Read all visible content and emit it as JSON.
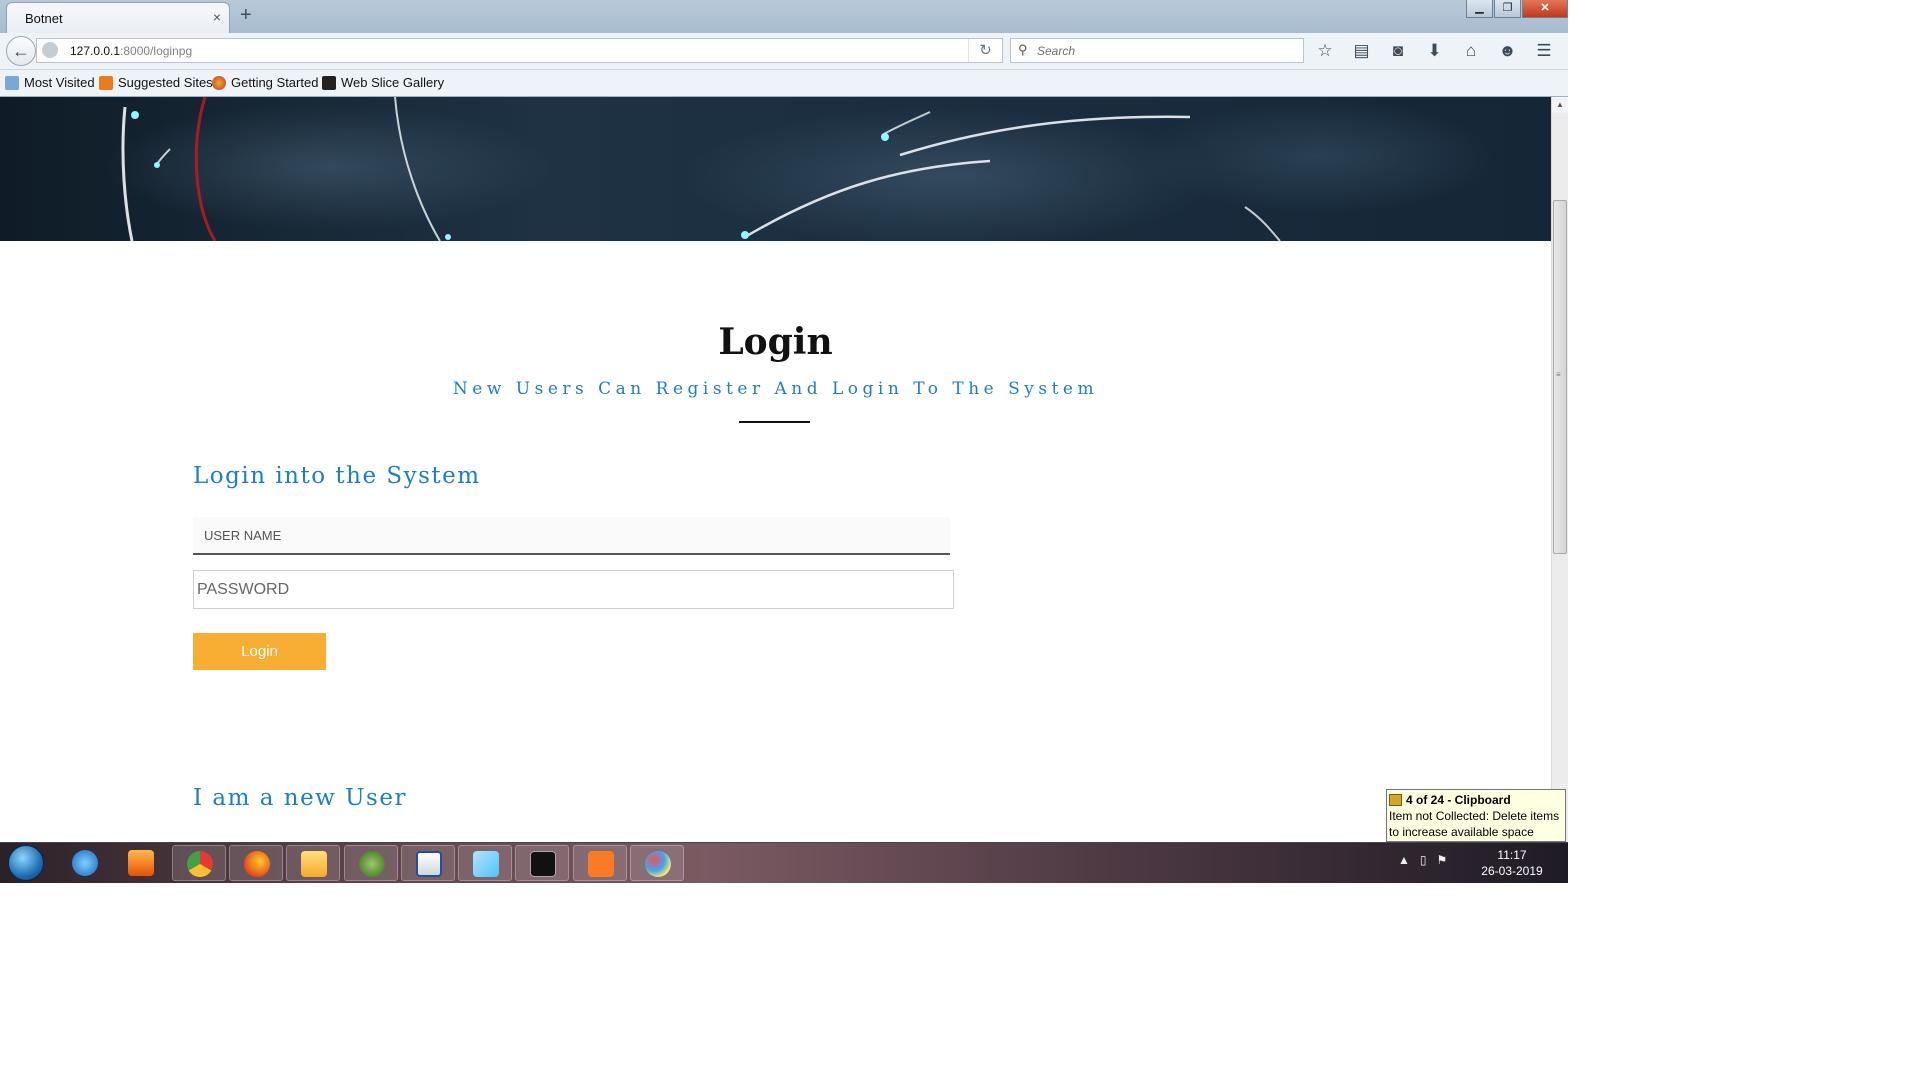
{
  "browser": {
    "tab_title": "Botnet",
    "tab_close": "×",
    "new_tab": "+",
    "url_host": "127.0.0.1",
    "url_path": ":8000/loginpg",
    "search_placeholder": "Search",
    "bookmarks": [
      "Most Visited",
      "Suggested Sites",
      "Getting Started",
      "Web Slice Gallery"
    ],
    "toolbar_icons": [
      "star-icon",
      "reading-list-icon",
      "pocket-icon",
      "download-icon",
      "home-icon",
      "smiley-icon",
      "menu-icon"
    ]
  },
  "page": {
    "title": "Login",
    "subtitle": "New Users Can Register And Login To The System",
    "login_heading": "Login into the System",
    "username_placeholder": "USER NAME",
    "password_placeholder": "PASSWORD",
    "login_button": "Login",
    "register_heading": "I am a new User",
    "colors": {
      "accent": "#1d7fbf",
      "button": "#f8ae32"
    }
  },
  "clipboard_popup": {
    "title": "4 of 24 - Clipboard",
    "message": "Item not Collected: Delete items to increase available space"
  },
  "taskbar": {
    "apps": [
      "internet-explorer",
      "media-player",
      "chrome",
      "firefox",
      "file-explorer",
      "utorrent",
      "word",
      "notepad",
      "command-prompt",
      "xampp",
      "paint"
    ],
    "time": "11:17",
    "date": "26-03-2019"
  }
}
